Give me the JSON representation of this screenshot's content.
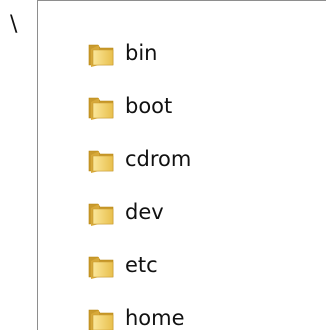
{
  "root": {
    "label": "\\"
  },
  "folders": [
    {
      "label": "bin"
    },
    {
      "label": "boot"
    },
    {
      "label": "cdrom"
    },
    {
      "label": "dev"
    },
    {
      "label": "etc"
    },
    {
      "label": "home"
    }
  ],
  "icon": {
    "name": "folder-icon",
    "colors": {
      "back": "#c99a2e",
      "front": "#f3d56b",
      "front_light": "#fbe79a",
      "tab": "#d7a93a",
      "edge": "#b8860b"
    }
  }
}
